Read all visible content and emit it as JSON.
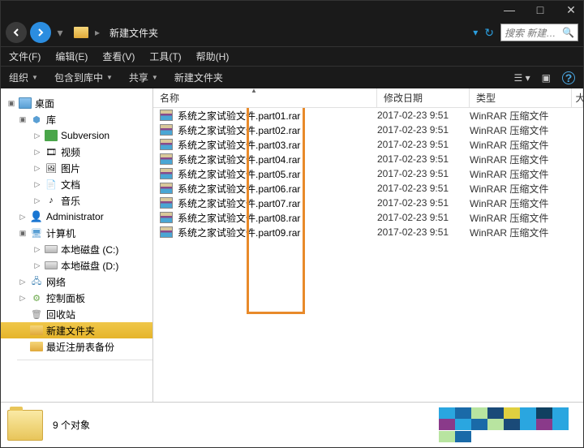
{
  "titlebar": {
    "min": "—",
    "max": "□",
    "close": "✕"
  },
  "nav": {
    "breadcrumb": "新建文件夹",
    "search_placeholder": "搜索 新建…"
  },
  "menu": {
    "file": "文件(F)",
    "edit": "编辑(E)",
    "view": "查看(V)",
    "tools": "工具(T)",
    "help": "帮助(H)"
  },
  "toolbar": {
    "organize": "组织",
    "include": "包含到库中",
    "share": "共享",
    "newfolder": "新建文件夹"
  },
  "tree": {
    "desktop": "桌面",
    "library": "库",
    "subversion": "Subversion",
    "video": "视频",
    "pictures": "图片",
    "documents": "文档",
    "music": "音乐",
    "admin": "Administrator",
    "computer": "计算机",
    "diskc": "本地磁盘 (C:)",
    "diskd": "本地磁盘 (D:)",
    "network": "网络",
    "control": "控制面板",
    "recycle": "回收站",
    "newfolder": "新建文件夹",
    "regbackup": "最近注册表备份"
  },
  "columns": {
    "name": "名称",
    "date": "修改日期",
    "type": "类型",
    "right": "大"
  },
  "files": [
    {
      "name": "系统之家试验文件.part01.rar",
      "date": "2017-02-23 9:51",
      "type": "WinRAR 压缩文件"
    },
    {
      "name": "系统之家试验文件.part02.rar",
      "date": "2017-02-23 9:51",
      "type": "WinRAR 压缩文件"
    },
    {
      "name": "系统之家试验文件.part03.rar",
      "date": "2017-02-23 9:51",
      "type": "WinRAR 压缩文件"
    },
    {
      "name": "系统之家试验文件.part04.rar",
      "date": "2017-02-23 9:51",
      "type": "WinRAR 压缩文件"
    },
    {
      "name": "系统之家试验文件.part05.rar",
      "date": "2017-02-23 9:51",
      "type": "WinRAR 压缩文件"
    },
    {
      "name": "系统之家试验文件.part06.rar",
      "date": "2017-02-23 9:51",
      "type": "WinRAR 压缩文件"
    },
    {
      "name": "系统之家试验文件.part07.rar",
      "date": "2017-02-23 9:51",
      "type": "WinRAR 压缩文件"
    },
    {
      "name": "系统之家试验文件.part08.rar",
      "date": "2017-02-23 9:51",
      "type": "WinRAR 压缩文件"
    },
    {
      "name": "系统之家试验文件.part09.rar",
      "date": "2017-02-23 9:51",
      "type": "WinRAR 压缩文件"
    }
  ],
  "status": {
    "count": "9 个对象"
  },
  "pixel_colors": [
    "#2aa6e0",
    "#1a6aa8",
    "#b8e4a0",
    "#1a4a78",
    "#e0d040",
    "#2aa6e0",
    "#104060",
    "#2aa6e0",
    "#8a3a8a",
    "#2aa6e0",
    "#1a6aa8",
    "#b8e4a0",
    "#1a4a78",
    "#2aa6e0",
    "#8a3a8a",
    "#2aa6e0",
    "#b8e4a0",
    "#1a6aa8"
  ]
}
